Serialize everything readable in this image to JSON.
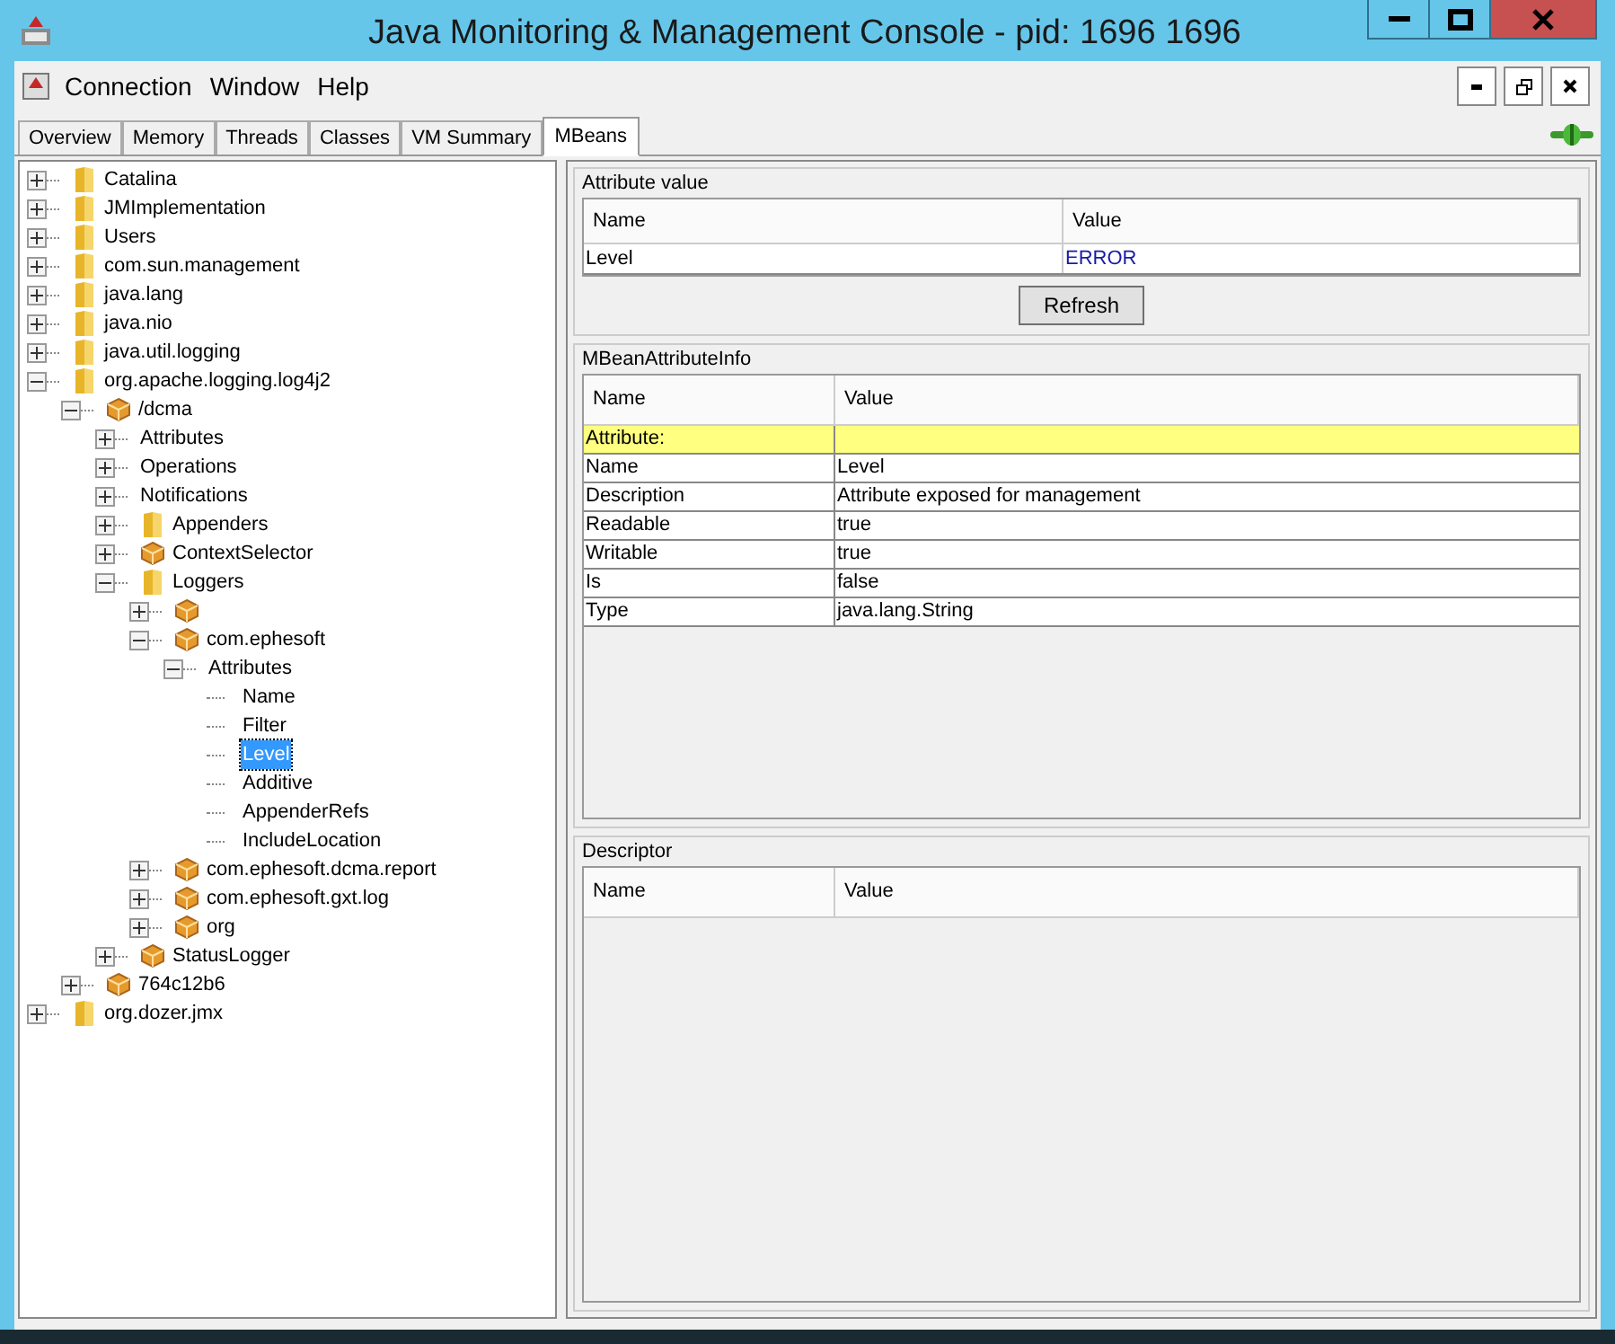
{
  "window": {
    "title": "Java Monitoring & Management Console - pid: 1696 1696"
  },
  "menu": [
    "Connection",
    "Window",
    "Help"
  ],
  "tabs": [
    {
      "label": "Overview",
      "selected": false
    },
    {
      "label": "Memory",
      "selected": false
    },
    {
      "label": "Threads",
      "selected": false
    },
    {
      "label": "Classes",
      "selected": false
    },
    {
      "label": "VM Summary",
      "selected": false
    },
    {
      "label": "MBeans",
      "selected": true
    }
  ],
  "tree": [
    {
      "label": "Catalina",
      "kind": "folder",
      "expanded": false,
      "selected": false
    },
    {
      "label": "JMImplementation",
      "kind": "folder",
      "expanded": false,
      "selected": false
    },
    {
      "label": "Users",
      "kind": "folder",
      "expanded": false,
      "selected": false
    },
    {
      "label": "com.sun.management",
      "kind": "folder",
      "expanded": false,
      "selected": false
    },
    {
      "label": "java.lang",
      "kind": "folder",
      "expanded": false,
      "selected": false
    },
    {
      "label": "java.nio",
      "kind": "folder",
      "expanded": false,
      "selected": false
    },
    {
      "label": "java.util.logging",
      "kind": "folder",
      "expanded": false,
      "selected": false
    },
    {
      "label": "org.apache.logging.log4j2",
      "kind": "folder",
      "expanded": true,
      "selected": false,
      "children": [
        {
          "label": "/dcma",
          "kind": "bean",
          "expanded": true,
          "selected": false,
          "children": [
            {
              "label": "Attributes",
              "kind": "group",
              "expanded": false,
              "selected": false
            },
            {
              "label": "Operations",
              "kind": "group",
              "expanded": false,
              "selected": false
            },
            {
              "label": "Notifications",
              "kind": "group",
              "expanded": false,
              "selected": false
            },
            {
              "label": "Appenders",
              "kind": "folder",
              "expanded": false,
              "selected": false
            },
            {
              "label": "ContextSelector",
              "kind": "bean",
              "expanded": false,
              "selected": false
            },
            {
              "label": "Loggers",
              "kind": "folder",
              "expanded": true,
              "selected": false,
              "children": [
                {
                  "kind": "bean",
                  "expanded": false,
                  "selected": false
                },
                {
                  "label": "com.ephesoft",
                  "kind": "bean",
                  "expanded": true,
                  "selected": false,
                  "children": [
                    {
                      "label": "Attributes",
                      "kind": "group",
                      "expanded": true,
                      "selected": false,
                      "children": [
                        {
                          "label": "Name",
                          "kind": "attribute",
                          "selected": false
                        },
                        {
                          "label": "Filter",
                          "kind": "attribute",
                          "selected": false
                        },
                        {
                          "label": "Level",
                          "kind": "attribute",
                          "selected": true
                        },
                        {
                          "label": "Additive",
                          "kind": "attribute",
                          "selected": false
                        },
                        {
                          "label": "AppenderRefs",
                          "kind": "attribute",
                          "selected": false
                        },
                        {
                          "label": "IncludeLocation",
                          "kind": "attribute",
                          "selected": false
                        }
                      ]
                    }
                  ]
                },
                {
                  "label": "com.ephesoft.dcma.report",
                  "kind": "bean",
                  "expanded": false,
                  "selected": false
                },
                {
                  "label": "com.ephesoft.gxt.log",
                  "kind": "bean",
                  "expanded": false,
                  "selected": false
                },
                {
                  "label": "org",
                  "kind": "bean",
                  "expanded": false,
                  "selected": false
                }
              ]
            },
            {
              "label": "StatusLogger",
              "kind": "bean",
              "expanded": false,
              "selected": false
            }
          ]
        },
        {
          "label": "764c12b6",
          "kind": "bean",
          "expanded": false,
          "selected": false
        }
      ]
    },
    {
      "label": "org.dozer.jmx",
      "kind": "folder",
      "expanded": false,
      "selected": false
    }
  ],
  "attribute_value": {
    "title": "Attribute value",
    "columns": [
      "Name",
      "Value"
    ],
    "rows": [
      {
        "name": "Level",
        "value": "ERROR"
      }
    ],
    "button": "Refresh"
  },
  "attribute_info": {
    "title": "MBeanAttributeInfo",
    "columns": [
      "Name",
      "Value"
    ],
    "rows": [
      {
        "kind": "header",
        "name": "Attribute:"
      },
      {
        "kind": "field",
        "name": "Name",
        "value": "Level"
      },
      {
        "kind": "field",
        "name": "Description",
        "value": "Attribute exposed for management"
      },
      {
        "kind": "field",
        "name": "Readable",
        "value": "true"
      },
      {
        "kind": "field",
        "name": "Writable",
        "value": "true"
      },
      {
        "kind": "field",
        "name": "Is",
        "value": "false"
      },
      {
        "kind": "field",
        "name": "Type",
        "value": "java.lang.String"
      }
    ]
  },
  "descriptor": {
    "title": "Descriptor",
    "columns": [
      "Name",
      "Value"
    ]
  }
}
